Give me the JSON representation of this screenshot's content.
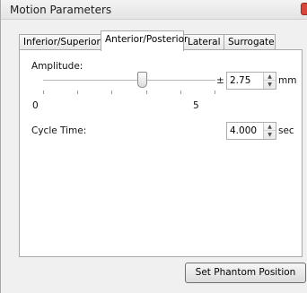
{
  "window": {
    "title": "Motion Parameters"
  },
  "tabs": [
    {
      "label": "Inferior/Superior",
      "active": false
    },
    {
      "label": "Anterior/Posterior",
      "active": true
    },
    {
      "label": "Lateral",
      "active": false
    },
    {
      "label": "Surrogate",
      "active": false
    }
  ],
  "amplitude": {
    "label": "Amplitude:",
    "slider_min_label": "0",
    "slider_max_label": "5",
    "slider_value": 2.75,
    "plus_minus": "±",
    "value": "2.75",
    "unit": "mm"
  },
  "cycle_time": {
    "label": "Cycle Time:",
    "value": "4.000",
    "unit": "sec"
  },
  "buttons": {
    "set_phantom_position": "Set Phantom Position"
  },
  "icons": {
    "close": "close-icon",
    "spin_up": "chevron-up-icon",
    "spin_down": "chevron-down-icon"
  }
}
